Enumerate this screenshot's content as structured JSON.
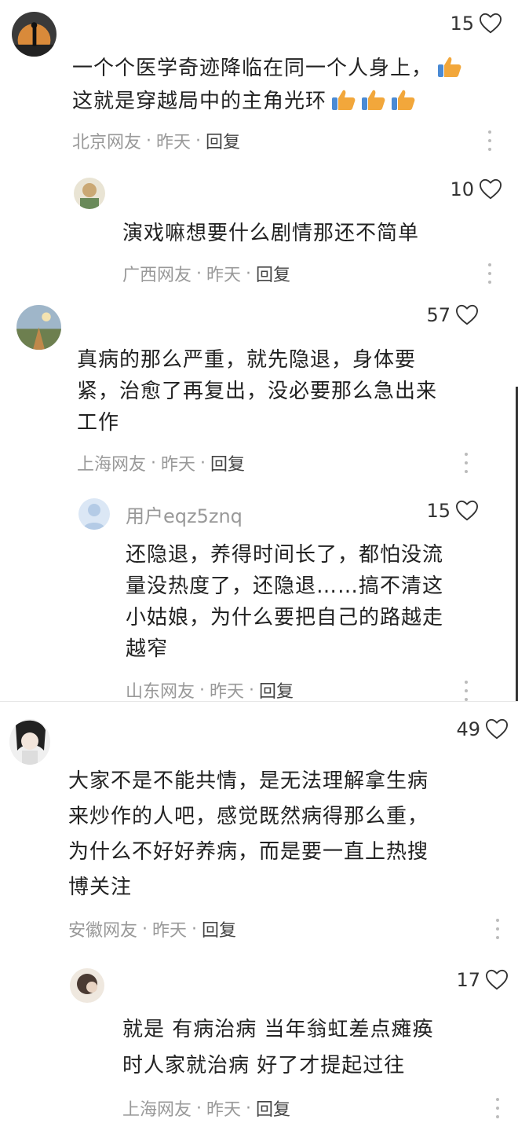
{
  "comments": [
    {
      "likes": "15",
      "line1": "一个个医学奇迹降临在同一个人身上，",
      "line2": "这就是穿越局中的主角光环",
      "location": "北京网友",
      "time": "昨天",
      "reply_label": "回复"
    },
    {
      "likes": "10",
      "line1": "演戏嘛想要什么剧情那还不简单",
      "location": "广西网友",
      "time": "昨天",
      "reply_label": "回复"
    },
    {
      "likes": "57",
      "line1": "真病的那么严重，就先隐退，身体要",
      "line2": "紧，治愈了再复出，没必要那么急出来",
      "line3": "工作",
      "location": "上海网友",
      "time": "昨天",
      "reply_label": "回复"
    },
    {
      "username": "用户eqz5znq",
      "likes": "15",
      "line1": "还隐退，养得时间长了，都怕没流",
      "line2": "量没热度了，还隐退……搞不清这",
      "line3": "小姑娘，为什么要把自己的路越走",
      "line4": "越窄",
      "location": "山东网友",
      "time": "昨天",
      "reply_label": "回复"
    },
    {
      "likes": "49",
      "line1": "大家不是不能共情，是无法理解拿生病",
      "line2": "来炒作的人吧，感觉既然病得那么重，",
      "line3": "为什么不好好养病，而是要一直上热搜",
      "line4": "博关注",
      "location": "安徽网友",
      "time": "昨天",
      "reply_label": "回复"
    },
    {
      "likes": "17",
      "line1": "就是 有病治病 当年翁虹差点瘫痪",
      "line2": "时人家就治病 好了才提起过往",
      "location": "上海网友",
      "time": "昨天",
      "reply_label": "回复"
    }
  ],
  "separator": "·",
  "colors": {
    "meta": "#999999",
    "text": "#222222",
    "thumb": "#f2a73b"
  },
  "icons": {
    "like": "heart-outline-icon",
    "more": "more-vertical-icon",
    "emoji": "thumbs-up-emoji-icon"
  }
}
